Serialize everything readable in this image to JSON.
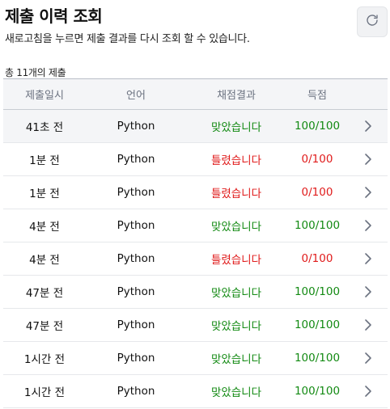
{
  "header": {
    "title": "제출 이력 조회",
    "subtitle": "새로고침을 누르면 제출 결과를 다시 조회 할 수 있습니다.",
    "refresh_icon": "refresh-icon"
  },
  "summary": {
    "count_text": "총 11개의 제출"
  },
  "table": {
    "columns": [
      "제출일시",
      "언어",
      "채점결과",
      "득점"
    ],
    "rows": [
      {
        "time": "41초 전",
        "language": "Python",
        "result": "맞았습니다",
        "score": "100/100",
        "status": "pass"
      },
      {
        "time": "1분 전",
        "language": "Python",
        "result": "틀렸습니다",
        "score": "0/100",
        "status": "fail"
      },
      {
        "time": "1분 전",
        "language": "Python",
        "result": "틀렸습니다",
        "score": "0/100",
        "status": "fail"
      },
      {
        "time": "4분 전",
        "language": "Python",
        "result": "맞았습니다",
        "score": "100/100",
        "status": "pass"
      },
      {
        "time": "4분 전",
        "language": "Python",
        "result": "틀렸습니다",
        "score": "0/100",
        "status": "fail"
      },
      {
        "time": "47분 전",
        "language": "Python",
        "result": "맞았습니다",
        "score": "100/100",
        "status": "pass"
      },
      {
        "time": "47분 전",
        "language": "Python",
        "result": "맞았습니다",
        "score": "100/100",
        "status": "pass"
      },
      {
        "time": "1시간 전",
        "language": "Python",
        "result": "맞았습니다",
        "score": "100/100",
        "status": "pass"
      },
      {
        "time": "1시간 전",
        "language": "Python",
        "result": "맞았습니다",
        "score": "100/100",
        "status": "pass"
      }
    ]
  },
  "colors": {
    "pass": "#138a13",
    "fail": "#e01b1b",
    "header_bg": "#f4f5f7"
  },
  "icons": {
    "row_action": "chevron-right-icon"
  }
}
